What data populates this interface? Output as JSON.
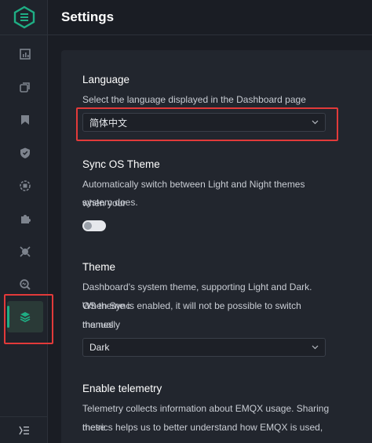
{
  "header": {
    "title": "Settings"
  },
  "sidebar": {
    "items": [
      {
        "icon": "dashboard-icon"
      },
      {
        "icon": "connections-icon"
      },
      {
        "icon": "rules-icon"
      },
      {
        "icon": "security-icon"
      },
      {
        "icon": "integration-icon"
      },
      {
        "icon": "plugins-icon"
      },
      {
        "icon": "diagnose-icon"
      },
      {
        "icon": "search-monitor-icon"
      },
      {
        "icon": "settings-layers-icon",
        "active": true
      }
    ],
    "accent": "#1fae84"
  },
  "language": {
    "heading": "Language",
    "description": "Select the language displayed in the Dashboard page",
    "value": "简体中文"
  },
  "sync_theme": {
    "heading": "Sync OS Theme",
    "description_line1": "Automatically switch between Light and Night themes when your",
    "description_line2": "system does.",
    "enabled": false
  },
  "theme": {
    "heading": "Theme",
    "description_line1": "Dashboard's system theme, supporting Light and Dark. When Sync",
    "description_line2": "OS theme is enabled, it will not be possible to switch themes",
    "description_line3": "manually",
    "value": "Dark"
  },
  "telemetry": {
    "heading": "Enable telemetry",
    "description_line1": "Telemetry collects information about EMQX usage. Sharing these",
    "description_line2": "metrics helps us to better understand how EMQX is used, so we"
  },
  "highlight_color": "#e23a3a"
}
